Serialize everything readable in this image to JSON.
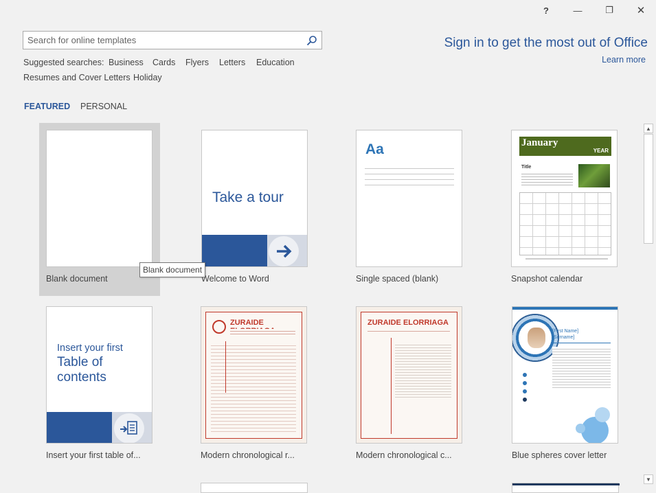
{
  "window": {
    "help": "?",
    "minimize": "—",
    "restore": "❐",
    "close": "✕"
  },
  "search": {
    "placeholder": "Search for online templates",
    "value": ""
  },
  "suggested": {
    "label": "Suggested searches:",
    "items": [
      "Business",
      "Cards",
      "Flyers",
      "Letters",
      "Education",
      "Resumes and Cover Letters",
      "Holiday"
    ]
  },
  "account": {
    "sign_in": "Sign in to get the most out of Office",
    "learn_more": "Learn more"
  },
  "tabs": {
    "featured": "FEATURED",
    "personal": "PERSONAL"
  },
  "templates": [
    {
      "label": "Blank document"
    },
    {
      "label": "Welcome to Word",
      "thumb_text": "Take a tour"
    },
    {
      "label": "Single spaced (blank)",
      "thumb_text": "Aa"
    },
    {
      "label": "Snapshot calendar",
      "thumb_month": "January",
      "thumb_year": "YEAR",
      "thumb_title": "Title"
    },
    {
      "label": "Insert your first table of...",
      "thumb_line1": "Insert your first",
      "thumb_line2": "Table of",
      "thumb_line3": "contents"
    },
    {
      "label": "Modern chronological r...",
      "thumb_name": "ZURAIDE ELORRIAGA"
    },
    {
      "label": "Modern chronological c...",
      "thumb_name": "ZURAIDE ELORRIAGA"
    },
    {
      "label": "Blue spheres cover letter",
      "thumb_name1": "[First Name]",
      "thumb_name2": "[Surname]"
    }
  ],
  "tooltip": "Blank document",
  "colors": {
    "accent": "#2b579a",
    "background": "#f1f1f1",
    "resume_red": "#c0392b",
    "calendar_green": "#4e6a1e"
  }
}
